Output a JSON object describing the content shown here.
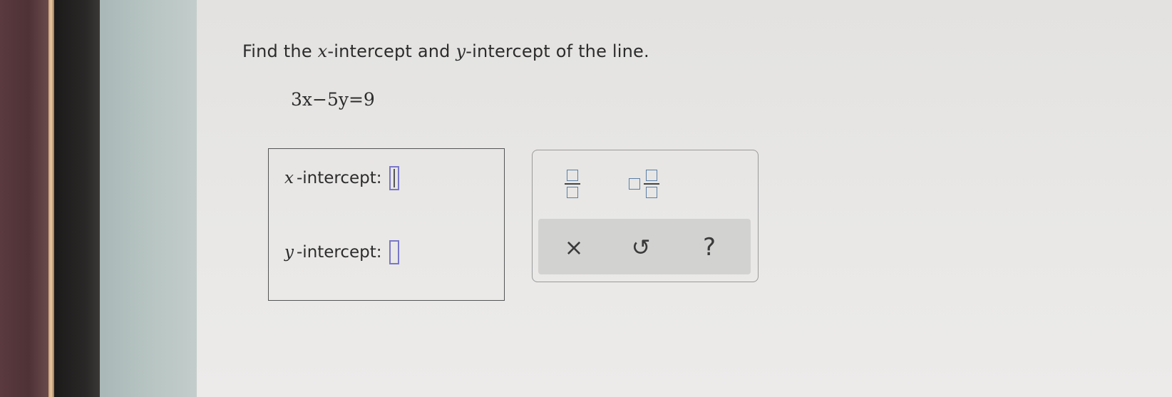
{
  "question": {
    "prefix": "Find the ",
    "x_var": "x",
    "mid": "-intercept and ",
    "y_var": "y",
    "suffix": "-intercept of the line."
  },
  "equation": "3x−5y=9",
  "answers": {
    "x_intercept": {
      "var": "x",
      "label": "-intercept:",
      "value": ""
    },
    "y_intercept": {
      "var": "y",
      "label": "-intercept:",
      "value": ""
    }
  },
  "toolbar": {
    "fraction_icon": "fraction-icon",
    "mixed_number_icon": "mixed-number-icon",
    "clear_glyph": "×",
    "undo_glyph": "↺",
    "help_glyph": "?"
  },
  "colors": {
    "input_border": "#7a77c9",
    "template_box": "#5a7fa8",
    "toolbar_bg": "#d2d2d1"
  }
}
